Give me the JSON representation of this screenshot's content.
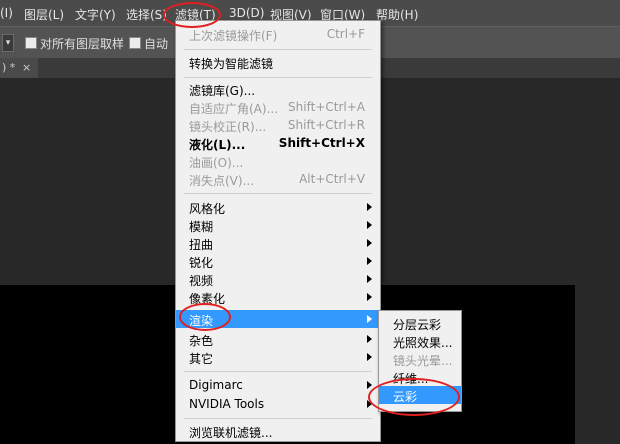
{
  "menubar": {
    "items": [
      {
        "label": "(I)"
      },
      {
        "label": "图层(L)"
      },
      {
        "label": "文字(Y)"
      },
      {
        "label": "选择(S)"
      },
      {
        "label": "滤镜(T)"
      },
      {
        "label": "3D(D)"
      },
      {
        "label": "视图(V)"
      },
      {
        "label": "窗口(W)"
      },
      {
        "label": "帮助(H)"
      }
    ]
  },
  "options": {
    "sample_all_layers": "对所有图层取样",
    "auto_label": "自动"
  },
  "tab": {
    "label": ") *",
    "close": "×"
  },
  "filter_menu": {
    "items": [
      {
        "label": "上次滤镜操作(F)",
        "shortcut": "Ctrl+F"
      },
      {
        "label": "转换为智能滤镜"
      },
      {
        "label": "滤镜库(G)..."
      },
      {
        "label": "自适应广角(A)...",
        "shortcut": "Shift+Ctrl+A"
      },
      {
        "label": "镜头校正(R)...",
        "shortcut": "Shift+Ctrl+R"
      },
      {
        "label": "液化(L)...",
        "shortcut": "Shift+Ctrl+X"
      },
      {
        "label": "油画(O)..."
      },
      {
        "label": "消失点(V)...",
        "shortcut": "Alt+Ctrl+V"
      },
      {
        "label": "风格化"
      },
      {
        "label": "模糊"
      },
      {
        "label": "扭曲"
      },
      {
        "label": "锐化"
      },
      {
        "label": "视频"
      },
      {
        "label": "像素化"
      },
      {
        "label": "渲染"
      },
      {
        "label": "杂色"
      },
      {
        "label": "其它"
      },
      {
        "label": "Digimarc"
      },
      {
        "label": "NVIDIA Tools"
      },
      {
        "label": "浏览联机滤镜..."
      }
    ]
  },
  "render_submenu": {
    "items": [
      {
        "label": "分层云彩"
      },
      {
        "label": "光照效果..."
      },
      {
        "label": "镜头光晕..."
      },
      {
        "label": "纤维..."
      },
      {
        "label": "云彩"
      }
    ]
  },
  "colors": {
    "highlight": "#3399ff",
    "annotation": "#e02020"
  }
}
